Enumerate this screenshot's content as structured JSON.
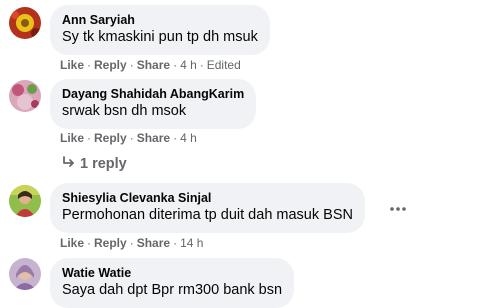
{
  "comments": [
    {
      "author": "Ann Saryiah",
      "text": "Sy tk kmaskini pun tp dh msuk",
      "like": "Like",
      "reply": "Reply",
      "share": "Share",
      "time": "4 h",
      "edited": "Edited"
    },
    {
      "author": "Dayang Shahidah AbangKarim",
      "text": "srwak bsn dh msok",
      "like": "Like",
      "reply": "Reply",
      "share": "Share",
      "time": "4 h"
    },
    {
      "author": "Shiesylia Clevanka Sinjal",
      "text": "Permohonan diterima tp duit dah masuk BSN",
      "like": "Like",
      "reply": "Reply",
      "share": "Share",
      "time": "14 h"
    },
    {
      "author": "Watie Watie",
      "text": "Saya dah dpt Bpr rm300 bank bsn"
    }
  ],
  "replies_link": "1 reply",
  "separator": "·",
  "icons": {
    "reply": "reply-arrow-icon",
    "more": "more-options-icon"
  },
  "colors": {
    "bubble": "#f0f2f5",
    "secondary_text": "#65676b",
    "primary_text": "#050505"
  }
}
